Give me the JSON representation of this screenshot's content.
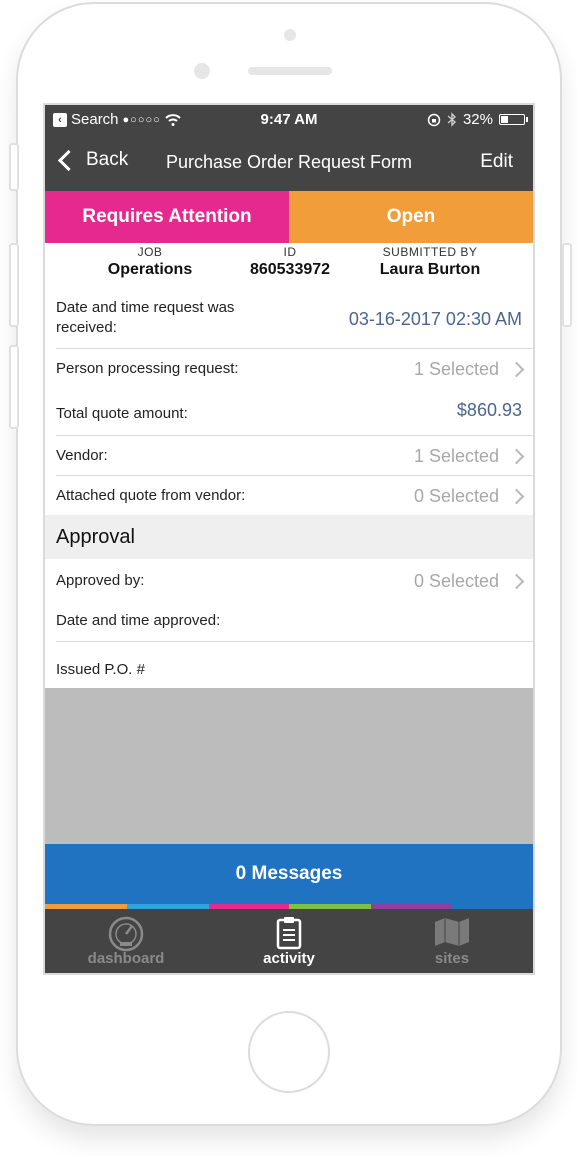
{
  "statusbar": {
    "carrier": "Search",
    "signal": "●○○○○",
    "time": "9:47 AM",
    "battery": "32%",
    "battery_level": 0.32
  },
  "navbar": {
    "back_label": "Back",
    "title": "Purchase Order Request Form",
    "edit_label": "Edit"
  },
  "status": {
    "attention_label": "Requires Attention",
    "open_label": "Open",
    "attention_color": "#e6298f",
    "open_color": "#f09d3a"
  },
  "meta": {
    "job_label": "JOB",
    "job_value": "Operations",
    "id_label": "ID",
    "id_value": "860533972",
    "submitted_label": "SUBMITTED BY",
    "submitted_value": "Laura Burton"
  },
  "fields": [
    {
      "label": "Date and time request was received:",
      "value": "03-16-2017 02:30 AM"
    },
    {
      "label": "Person processing request:",
      "value": "1 Selected"
    },
    {
      "label": "Total quote amount:",
      "value": "$860.93"
    },
    {
      "label": "Vendor:",
      "value": "1 Selected"
    },
    {
      "label": "Attached quote from vendor:",
      "value": "0 Selected"
    }
  ],
  "approval": {
    "header": "Approval",
    "fields": [
      {
        "label": "Approved by:",
        "value": "0 Selected"
      },
      {
        "label": "Date and time approved:",
        "value": ""
      },
      {
        "label": "Issued P.O. #",
        "value": ""
      }
    ]
  },
  "messages": {
    "label": "0 Messages",
    "color": "#1f73c1"
  },
  "stripe_colors": [
    "#f09d3a",
    "#2ba7e0",
    "#e6298f",
    "#7dc242",
    "#8e3fa0",
    "#1f73c1"
  ],
  "tabs": [
    {
      "label": "dashboard",
      "icon": "speedometer-icon",
      "active": false
    },
    {
      "label": "activity",
      "icon": "clipboard-icon",
      "active": true
    },
    {
      "label": "sites",
      "icon": "map-icon",
      "active": false
    }
  ]
}
